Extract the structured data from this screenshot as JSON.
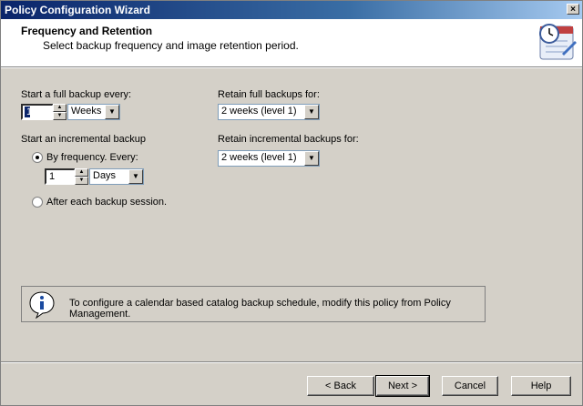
{
  "window": {
    "title": "Policy Configuration Wizard",
    "close_glyph": "×"
  },
  "header": {
    "title": "Frequency and Retention",
    "subtitle": "Select backup frequency and image retention period.",
    "icon": "calendar-clock-icon"
  },
  "full_backup": {
    "label": "Start a full backup every:",
    "value": "1",
    "unit": "Weeks"
  },
  "retain_full": {
    "label": "Retain full backups for:",
    "value": "2 weeks (level 1)"
  },
  "incremental": {
    "label": "Start an incremental backup",
    "by_frequency_label": "By frequency. Every:",
    "value": "1",
    "unit": "Days",
    "after_session_label": "After each backup session."
  },
  "retain_incremental": {
    "label": "Retain incremental backups for:",
    "value": "2 weeks (level 1)"
  },
  "info": {
    "icon": "info-icon",
    "text": "To configure a calendar based catalog backup schedule, modify this policy from Policy Management."
  },
  "buttons": {
    "back": "< Back",
    "next": "Next >",
    "cancel": "Cancel",
    "help": "Help"
  },
  "glyphs": {
    "up": "▲",
    "down": "▼"
  }
}
